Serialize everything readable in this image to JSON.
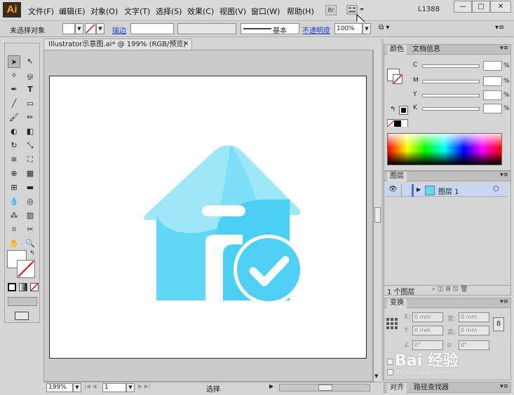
{
  "app": {
    "logo": "Ai"
  },
  "menu": [
    "文件(F)",
    "编辑(E)",
    "对象(O)",
    "文字(T)",
    "选择(S)",
    "效果(C)",
    "视图(V)",
    "窗口(W)",
    "帮助(H)"
  ],
  "menubar_right": {
    "br_label": "Br",
    "workspace": "L1388",
    "min": "—",
    "max": "□",
    "close": "✕"
  },
  "control": {
    "selection_label": "未选择对象",
    "stroke_link": "描边",
    "stroke_profile": "基本",
    "opacity_link": "不透明度",
    "opacity_value": "100%"
  },
  "document": {
    "tab_title": "Illustrator示意图.ai* @ 199% (RGB/预览)",
    "tab_close": "✕"
  },
  "status": {
    "zoom": "199%",
    "page": "1",
    "tool": "选择"
  },
  "color_panel": {
    "tabs": [
      "颜色",
      "文档信息"
    ],
    "channels": [
      {
        "name": "C",
        "value": "",
        "unit": "%"
      },
      {
        "name": "M",
        "value": "",
        "unit": "%"
      },
      {
        "name": "Y",
        "value": "",
        "unit": "%"
      },
      {
        "name": "K",
        "value": "",
        "unit": "%"
      }
    ]
  },
  "layers_panel": {
    "title": "图层",
    "layers": [
      {
        "name": "图层 1"
      }
    ],
    "footer_count": "1 个图层"
  },
  "transform_panel": {
    "title": "变换",
    "x": "0 mm",
    "y": "0 mm",
    "w": "0 mm",
    "h": "0 mm",
    "rotate": "0°",
    "shear": "0°",
    "labels": {
      "x": "X:",
      "y": "Y:",
      "w": "宽:",
      "h": "高:"
    }
  },
  "bottom_tabs": [
    "对齐",
    "路径查找器"
  ],
  "watermark": "Bai 经验",
  "watermark_url": "jingyan.baidu.com",
  "colors": {
    "house_light": "#9ee7f8",
    "house_main": "#63d7f6",
    "check_circle": "#4fcff4"
  }
}
